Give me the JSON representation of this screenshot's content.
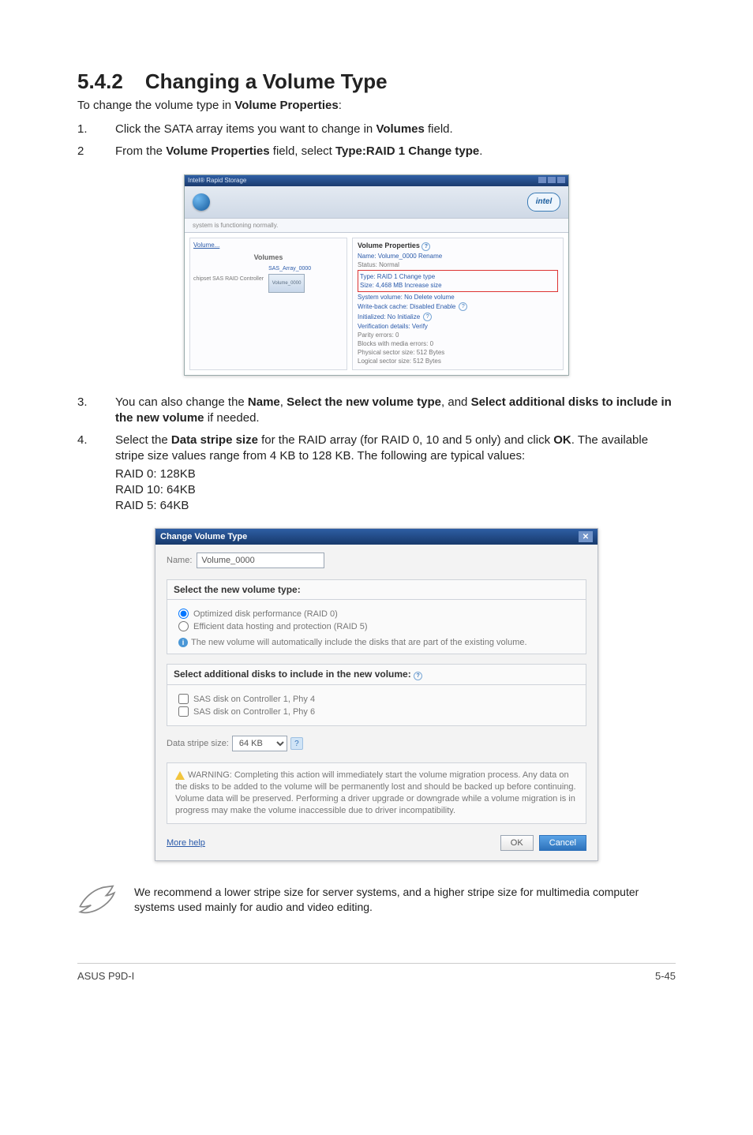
{
  "section": {
    "number": "5.4.2",
    "title": "Changing a Volume Type"
  },
  "intro_prefix": "To change the volume type in ",
  "intro_bold": "Volume Properties",
  "intro_suffix": ":",
  "steps": {
    "s1": {
      "num": "1.",
      "t1": "Click the SATA array items you want to change in ",
      "b1": "Volumes",
      "t2": " field."
    },
    "s2": {
      "num": "2",
      "t1": "From the ",
      "b1": "Volume Properties",
      "t2": " field, select ",
      "b2": "Type:RAID 1 Change type",
      "t3": "."
    },
    "s3": {
      "num": "3.",
      "t1": "You can also change the ",
      "b1": "Name",
      "t2": ", ",
      "b2": "Select the new volume type",
      "t3": ", and ",
      "b3": "Select additional disks to include in the new volume",
      "t4": " if needed."
    },
    "s4": {
      "num": "4.",
      "t1": "Select the ",
      "b1": "Data stripe size",
      "t2": " for the RAID array (for RAID 0, 10 and 5 only) and click ",
      "b2": "OK",
      "t3": ". The available stripe size values range from 4 KB to 128 KB. The following are typical values:",
      "l1": "RAID 0: 128KB",
      "l2": "RAID 10: 64KB",
      "l3": "RAID 5: 64KB"
    }
  },
  "irst": {
    "titlebar": "Intel® Rapid Storage",
    "intel": "intel",
    "status": "system is functioning normally.",
    "vol_link": "Volume...",
    "vol_header": "Volumes",
    "controller": "chipset SAS RAID Controller",
    "drive1": "SAS_Array_0000",
    "drive2": "Volume_0000",
    "right": {
      "title": "Volume Properties",
      "name": "Name: Volume_0000 Rename",
      "status_line": "Status: Normal",
      "type_line": "Type: RAID 1 Change type",
      "size": "Size: 4,468 MB Increase size",
      "sys": "System volume: No Delete volume",
      "wb": "Write-back cache: Disabled Enable",
      "init": "Initialized: No Initialize",
      "verify": "Verification details: Verify",
      "parity": "Parity errors: 0",
      "blocks": "Blocks with media errors: 0",
      "phys": "Physical sector size: 512 Bytes",
      "log": "Logical sector size: 512 Bytes"
    }
  },
  "cvt": {
    "title": "Change Volume Type",
    "name_label": "Name:",
    "name_value": "Volume_0000",
    "group1_hdr": "Select the new volume type:",
    "radio1": "Optimized disk performance (RAID 0)",
    "radio2": "Efficient data hosting and protection (RAID 5)",
    "info_line": "The new volume will automatically include the disks that are part of the existing volume.",
    "group2_hdr": "Select additional disks to include in the new volume:",
    "chk1": "SAS disk on Controller 1, Phy 4",
    "chk2": "SAS disk on Controller 1, Phy 6",
    "stripe_label": "Data stripe size:",
    "stripe_value": "64 KB",
    "warning": "WARNING: Completing this action will immediately start the volume migration process. Any data on the disks to be added to the volume will be permanently lost and should be backed up before continuing. Volume data will be preserved. Performing a driver upgrade or downgrade while a volume migration is in progress may make the volume inaccessible due to driver incompatibility.",
    "more_help": "More help",
    "ok": "OK",
    "cancel": "Cancel"
  },
  "note": "We recommend a lower stripe size for server systems, and a higher stripe size for multimedia computer systems used mainly for audio and video editing.",
  "footer": {
    "left": "ASUS P9D-I",
    "right": "5-45"
  }
}
